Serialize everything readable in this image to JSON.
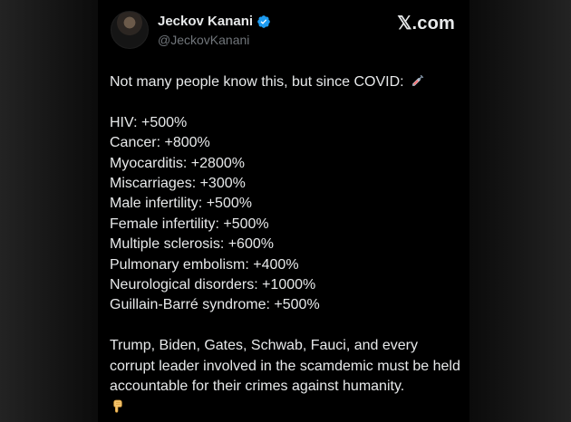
{
  "tweet": {
    "author_name": "Jeckov Kanani",
    "handle": "@JeckovKanani",
    "brand": "𝕏.com",
    "intro": "Not many people know this, but since COVID:",
    "stats": [
      "HIV: +500%",
      "Cancer: +800%",
      "Myocarditis: +2800%",
      "Miscarriages: +300%",
      "Male infertility: +500%",
      "Female infertility: +500%",
      "Multiple sclerosis: +600%",
      "Pulmonary embolism: +400%",
      "Neurological disorders: +1000%",
      "Guillain-Barré syndrome: +500%"
    ],
    "closing": "Trump, Biden, Gates, Schwab, Fauci, and every corrupt leader involved in the scamdemic must be held accountable for their crimes against humanity."
  },
  "icons": {
    "verified": "verified-badge-icon",
    "intro_emoji": "syringe-icon",
    "closing_emoji": "pointing-down-hand-icon",
    "avatar": "avatar"
  },
  "colors": {
    "background": "#000000",
    "text": "#e7e9ea",
    "secondary_text": "#71767b",
    "verified": "#1d9bf0"
  }
}
